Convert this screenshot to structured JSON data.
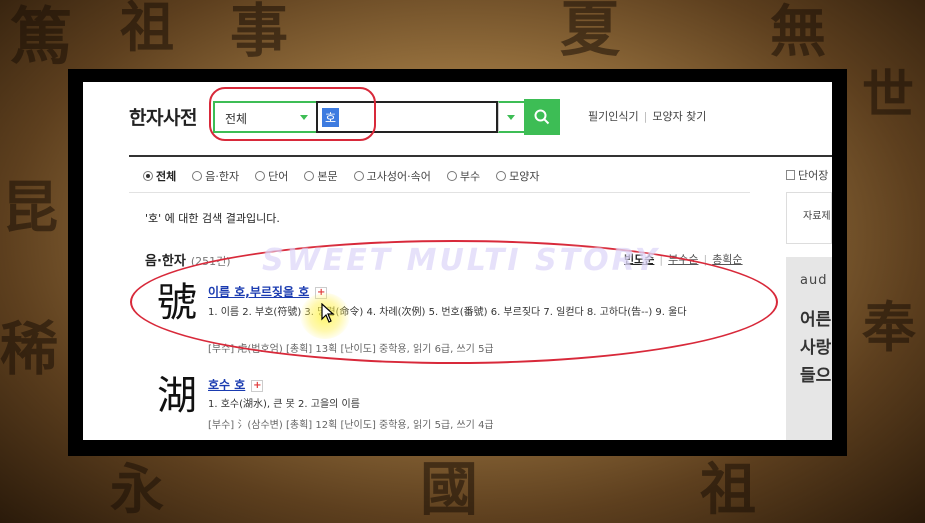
{
  "background_glyphs": [
    "篤",
    "祖",
    "事",
    "夏",
    "無",
    "世",
    "昆",
    "稀",
    "永",
    "國",
    "祖",
    "奉"
  ],
  "header": {
    "logo": "한자사전",
    "scope_select": "전체",
    "query": "호",
    "search_icon": "search-icon",
    "tools": [
      "필기인식기",
      "모양자 찾기"
    ]
  },
  "filters": [
    {
      "label": "전체",
      "selected": true
    },
    {
      "label": "음·한자",
      "selected": false
    },
    {
      "label": "단어",
      "selected": false
    },
    {
      "label": "본문",
      "selected": false
    },
    {
      "label": "고사성어·속어",
      "selected": false
    },
    {
      "label": "부수",
      "selected": false
    },
    {
      "label": "모양자",
      "selected": false
    }
  ],
  "summary": "'호' 에 대한 검색 결과입니다.",
  "section": {
    "title": "음·한자",
    "count": "(251건)",
    "sorts": [
      "빈도순",
      "부수순",
      "총획순"
    ],
    "active_sort": "빈도순"
  },
  "entries": [
    {
      "hanja": "號",
      "title": "이름 호,부르짖을 호",
      "meaning": "1. 이름 2. 부호(符號) 3. 명령(命令) 4. 차례(次例) 5. 번호(番號) 6. 부르짖다 7. 일컫다 8. 고하다(告--) 9. 울다",
      "meta": "[부수] 虍(범호엄)  [총획] 13획  [난이도] 중학용, 읽기 6급, 쓰기 5급"
    },
    {
      "hanja": "湖",
      "title": "호수 호",
      "meaning": "1. 호수(湖水), 큰 못 2. 고을의 이름",
      "meta": "[부수] 氵(삼수변)  [총획] 12획  [난이도] 중학용, 읽기 5급, 쓰기 4급"
    }
  ],
  "sidebar": {
    "tab": "단어장",
    "box_label": "자료제",
    "ad_brand": "aud",
    "ad_lines": [
      "어른",
      "사랑",
      "들으"
    ]
  },
  "watermark": "SWEET MULTI STORY",
  "colors": {
    "accent_green": "#3dbd55",
    "highlight_red": "#d8293a",
    "link_blue": "#1a3bb0"
  }
}
